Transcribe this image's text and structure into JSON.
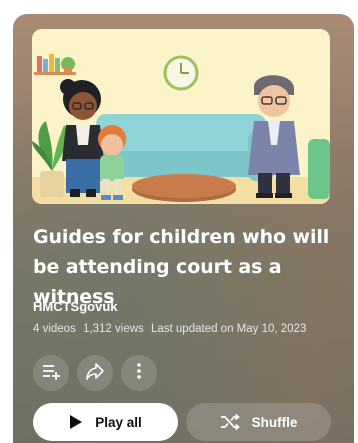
{
  "playlist": {
    "title": "Guides for children who will be attending court as a witness",
    "channel": "HMCTSgovuk",
    "video_count": "4 videos",
    "views": "1,312 views",
    "updated": "Last updated on May 10, 2023"
  },
  "actions": {
    "save_icon": "playlist-add-icon",
    "share_icon": "share-icon",
    "more_icon": "more-vertical-icon",
    "play_all_label": "Play all",
    "shuffle_label": "Shuffle"
  },
  "colors": {
    "thumbnail_background": "#fdf3c9",
    "play_button": "#ffffff",
    "text": "#ffffff"
  }
}
